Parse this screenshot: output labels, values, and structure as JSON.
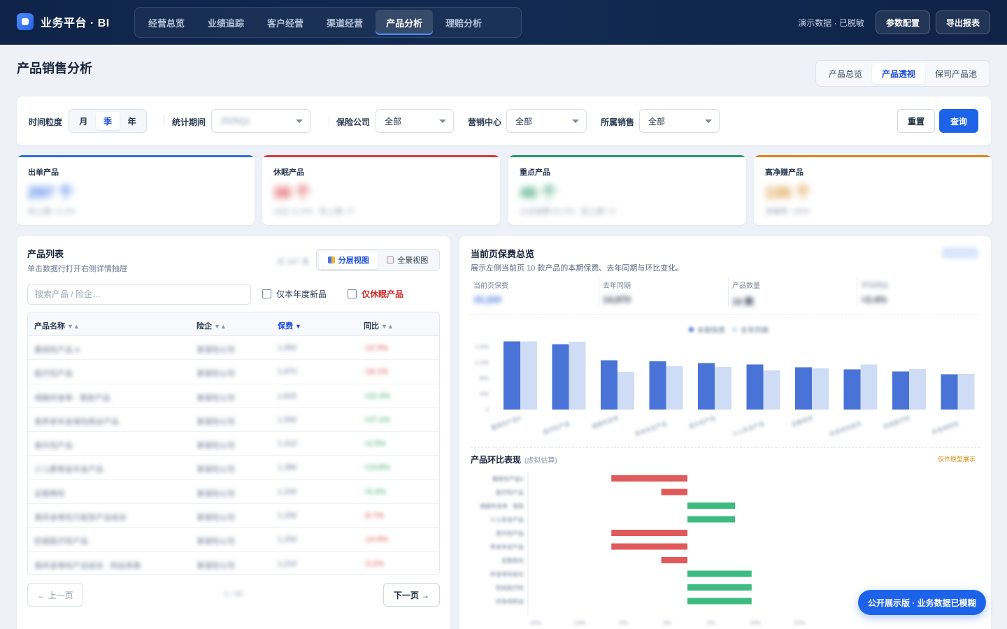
{
  "brand": {
    "name": "业务平台 · BI"
  },
  "nav": [
    "经营总览",
    "业绩追踪",
    "客户经营",
    "渠道经营",
    "产品分析",
    "理赔分析"
  ],
  "nav_active": 4,
  "topbar": {
    "status": "演示数据 · 已脱敏",
    "config_button": "参数配置",
    "export_button": "导出报表"
  },
  "page": {
    "title": "产品销售分析"
  },
  "subtabs": [
    "产品总览",
    "产品透视",
    "保司产品池"
  ],
  "subtab_active": 1,
  "filters": {
    "granularity_label": "时间粒度",
    "granularity": [
      "月",
      "季",
      "年"
    ],
    "granularity_active": 1,
    "period_label": "统计期间",
    "period_value": "2025Q1",
    "insurer_label": "保险公司",
    "insurer_value": "全部",
    "center_label": "营销中心",
    "center_value": "全部",
    "sales_label": "所属销售",
    "sales_value": "全部",
    "reset": "重置",
    "query": "查询"
  },
  "kpis": [
    {
      "title": "出单产品",
      "value": "297 个",
      "sub": "较上期 +2.3%",
      "color": "#2f6fe4"
    },
    {
      "title": "休眠产品",
      "value": "38 个",
      "sub": "占比 12.8% · 较上期 +5",
      "color": "#d9383a"
    },
    {
      "title": "重点产品",
      "value": "46 个",
      "sub": "占总保费 62.4% · 较上期 +3",
      "color": "#26996a"
    },
    {
      "title": "高净赚产品",
      "value": "135 个",
      "sub": "净赚率 >30%",
      "color": "#d9861a"
    }
  ],
  "list": {
    "title": "产品列表",
    "subtitle": "单击数据行打开右侧详情抽屉",
    "count": "共 297 条",
    "view_layered": "分层视图",
    "view_full": "全景视图",
    "search_placeholder": "搜索产品 / 险企…",
    "chk_new": "仅本年度新品",
    "chk_dormant": "仅休眠产品",
    "columns": [
      "产品名称",
      "险企",
      "保费",
      "同比"
    ],
    "sort_marks": [
      "▼▲",
      "▼▲",
      "▼",
      "▼▲"
    ],
    "rows": [
      {
        "name": "重疾险产品 A",
        "insurer": "某保险公司",
        "premium": "1,950",
        "yoy": "-12.3%",
        "trend": "neg"
      },
      {
        "name": "医疗险产品",
        "insurer": "某保险公司",
        "premium": "1,870",
        "yoy": "-16.1%",
        "trend": "neg"
      },
      {
        "name": "增额终身寿 · 某款产品",
        "insurer": "某保险公司",
        "premium": "1,620",
        "yoy": "+22.4%",
        "trend": "pos"
      },
      {
        "name": "某养老年金保险两全产品",
        "insurer": "某保险公司",
        "premium": "1,560",
        "yoy": "+27.1%",
        "trend": "pos"
      },
      {
        "name": "意外险产品",
        "insurer": "某保险公司",
        "premium": "1,410",
        "yoy": "+2.5%",
        "trend": "pos"
      },
      {
        "name": "少儿教育金年金产品",
        "insurer": "某保险公司",
        "premium": "1,380",
        "yoy": "+19.8%",
        "trend": "pos"
      },
      {
        "name": "定期寿险",
        "insurer": "某保险公司",
        "premium": "1,330",
        "yoy": "+6.4%",
        "trend": "pos"
      },
      {
        "name": "某终身寿险万能型产品组合",
        "insurer": "某保险公司",
        "premium": "1,290",
        "yoy": "-8.7%",
        "trend": "neg"
      },
      {
        "name": "防癌医疗险产品",
        "insurer": "某保险公司",
        "premium": "1,250",
        "yoy": "-14.9%",
        "trend": "neg"
      },
      {
        "name": "某终身寿险产品组合 · 附加条款",
        "insurer": "某保险公司",
        "premium": "1,210",
        "yoy": "-3.2%",
        "trend": "neg"
      }
    ],
    "prev": "← 上一页",
    "page_info": "1 / 30",
    "next": "下一页 →"
  },
  "overview": {
    "title": "当前页保费总览",
    "subtitle": "展示左侧当前页 10 款产品的本期保费、去年同期与环比变化。",
    "tag": "导出图片",
    "stats": [
      {
        "label": "当前页保费",
        "value": "15,220"
      },
      {
        "label": "去年同期",
        "value": "14,870"
      },
      {
        "label": "产品数量",
        "value": "10 款"
      },
      {
        "label": "平均同比",
        "value": "+2.4%"
      }
    ]
  },
  "section2": {
    "title": "产品环比表现",
    "note": "(虚拟估算)",
    "badge": "仅作原型展示"
  },
  "float_badge": "公开展示版 · 业务数据已模糊",
  "chart_data": [
    {
      "type": "bar",
      "categories": [
        "重疾险产品A",
        "医疗险产品",
        "增额终身寿",
        "养老年金产品",
        "意外险产品",
        "少儿年金产品",
        "定期寿险",
        "终身寿险组合",
        "防癌医疗险",
        "终身寿附加"
      ],
      "series": [
        {
          "name": "本期保费",
          "values": [
            1950,
            1870,
            1410,
            1380,
            1330,
            1290,
            1210,
            1150,
            1090,
            1010
          ],
          "color": "#4a73d8"
        },
        {
          "name": "去年同期",
          "values": [
            1950,
            1940,
            1080,
            1240,
            1220,
            1120,
            1180,
            1290,
            1160,
            1020
          ],
          "color": "#cfdcf6"
        }
      ],
      "yticks": [
        "1,600",
        "1,200",
        "800",
        "400",
        "0"
      ],
      "ylim": [
        0,
        2000
      ]
    },
    {
      "type": "bar",
      "orientation": "horizontal",
      "categories": [
        "重疾险产品A",
        "医疗险产品",
        "增额终身寿 · 某款",
        "少儿年金产品",
        "意外险产品",
        "养老年金产品",
        "定期寿险",
        "终身寿险组合",
        "防癌医疗险",
        "终身寿附加"
      ],
      "values": [
        -16,
        -5.5,
        10,
        10,
        -16,
        -16,
        -5.5,
        13.5,
        13.5,
        13.5
      ],
      "xticks": [
        "-15%",
        "-10%",
        "-5%",
        "0%",
        "5%",
        "10%",
        "15%"
      ],
      "xlim": [
        -20,
        20
      ]
    }
  ]
}
